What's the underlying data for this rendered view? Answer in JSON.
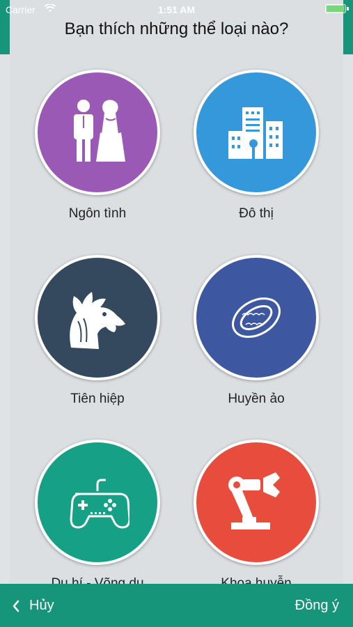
{
  "status": {
    "carrier": "Carrier",
    "time": "1:51 AM"
  },
  "title": "Bạn thích những thể loại nào?",
  "genres": [
    {
      "label": "Ngôn tình",
      "color": "#9b59b6",
      "icon": "couple-icon"
    },
    {
      "label": "Đô thị",
      "color": "#3498db",
      "icon": "city-buildings-icon"
    },
    {
      "label": "Tiên hiệp",
      "color": "#34495e",
      "icon": "dragon-icon"
    },
    {
      "label": "Huyền ảo",
      "color": "#3d58a0",
      "icon": "magic-ring-icon"
    },
    {
      "label": "Du hí - Võng du",
      "color": "#16a085",
      "icon": "gamepad-icon"
    },
    {
      "label": "Khoa huyễn",
      "color": "#e74c3c",
      "icon": "robot-arm-icon"
    }
  ],
  "footer": {
    "cancel": "Hủy",
    "agree": "Đồng ý"
  }
}
